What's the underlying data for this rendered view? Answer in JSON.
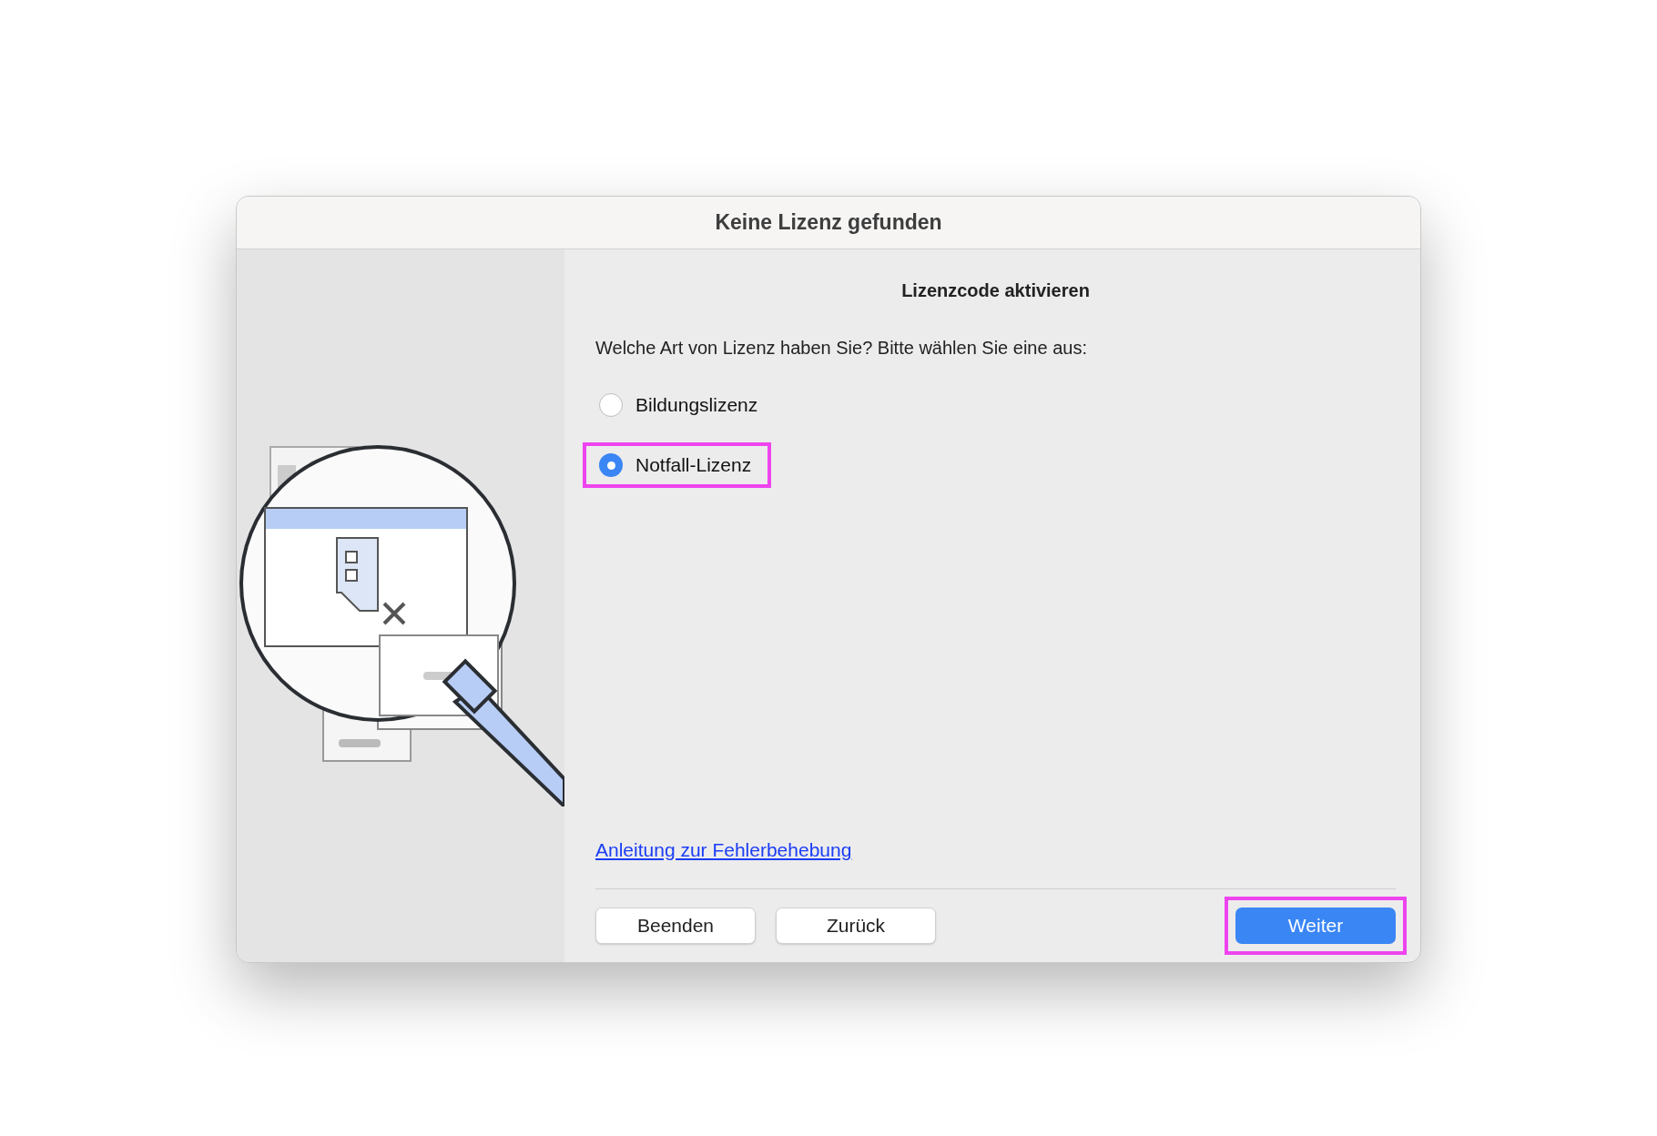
{
  "window": {
    "title": "Keine Lizenz gefunden"
  },
  "content": {
    "heading": "Lizenzcode aktivieren",
    "question": "Welche Art von Lizenz haben Sie? Bitte wählen Sie eine aus:",
    "options": [
      {
        "label": "Bildungslizenz",
        "selected": false,
        "highlighted": false
      },
      {
        "label": "Notfall-Lizenz",
        "selected": true,
        "highlighted": true
      }
    ],
    "link": "Anleitung zur Fehlerbehebung"
  },
  "buttons": [
    {
      "label": "Beenden",
      "kind": "secondary",
      "highlighted": false
    },
    {
      "label": "Zurück",
      "kind": "secondary",
      "highlighted": false
    },
    {
      "label": "Weiter",
      "kind": "primary",
      "highlighted": true
    }
  ]
}
